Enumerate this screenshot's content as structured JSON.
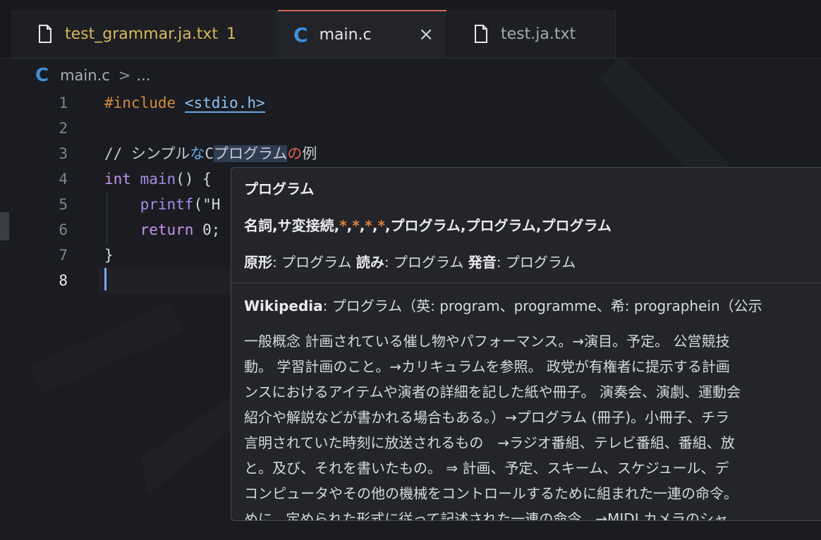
{
  "tabs": [
    {
      "label": "test_grammar.ja.txt",
      "badge": "1"
    },
    {
      "label": "main.c",
      "close": "×"
    },
    {
      "label": "test.ja.txt"
    }
  ],
  "breadcrumb": {
    "file": "main.c",
    "sep": ">",
    "more": "..."
  },
  "editor": {
    "line_numbers": [
      "1",
      "2",
      "3",
      "4",
      "5",
      "6",
      "7",
      "8"
    ],
    "code": {
      "l1_directive": "#include",
      "l1_header": "<stdio.h>",
      "l3_a": "// シンプル",
      "l3_b": "な",
      "l3_c": "C",
      "l3_d": "プログラム",
      "l3_e": "の",
      "l3_f": "例",
      "l4_kw": "int",
      "l4_fn": "main",
      "l4_rest": "() {",
      "l5_fn": "printf",
      "l5_rest": "(\"H",
      "l6_kw": "return",
      "l6_rest": " 0;",
      "l7": "}"
    }
  },
  "hover": {
    "word": "プログラム",
    "pos_line": {
      "a": "名詞,サ変接続,",
      "s1": "*",
      "c1": ",",
      "s2": "*",
      "c2": ",",
      "s3": "*",
      "c3": ",",
      "s4": "*",
      "b": ",プログラム,プログラム,プログラム"
    },
    "forms": {
      "base_label": "原形",
      "base_value": ": プログラム ",
      "reading_label": "読み",
      "reading_value": ": プログラム ",
      "pron_label": "発音",
      "pron_value": ": プログラム"
    },
    "wiki_label": "Wikipedia",
    "wiki_head": ": プログラム（英: program、programme、希: prographein（公示",
    "body_lines": [
      "一般概念 計画されている催し物やパフォーマンス。→演目。予定。 公営競技",
      "動。 学習計画のこと。→カリキュラムを参照。 政党が有権者に提示する計画",
      "ンスにおけるアイテムや演者の詳細を記した紙や冊子。 演奏会、演劇、運動会",
      "紹介や解説などが書かれる場合もある。）→プログラム (冊子)。小冊子、チラ",
      "言明されていた時刻に放送されるもの　→ラジオ番組、テレビ番組、番組、放",
      "と。及び、それを書いたもの。 ⇒ 計画、予定、スキーム、スケジュール、デ",
      "コンピュータやその他の機械をコントロールするために組まれた一連の命令。",
      "めに、定められた形式に従って記述された一連の命令。→MIDI,カメラのシャ"
    ]
  }
}
